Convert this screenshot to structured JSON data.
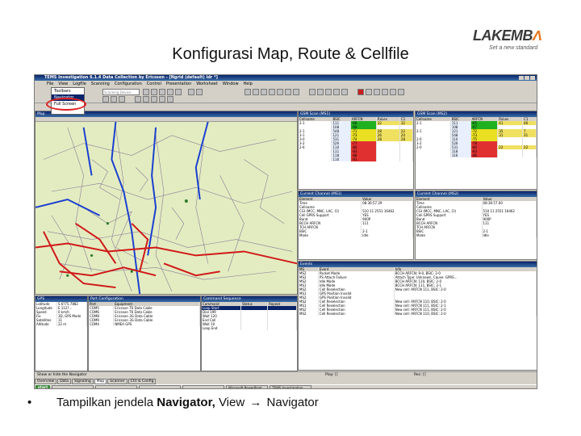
{
  "slide": {
    "title": "Konfigurasi Map, Route & Cellfile",
    "logo": {
      "word_a": "LAKEMB",
      "word_b": "Λ",
      "tagline": "Set a new standard"
    },
    "bullet": "•",
    "caption_prefix": "Tampilkan jendela ",
    "caption_bold": "Navigator,",
    "caption_view": " View ",
    "caption_arrow": "→",
    "caption_target": " Navigator"
  },
  "app": {
    "title": "TEMS Investigation 6.1.4 Data Collection by Ericsson - [Ngrid (default) ldr *]",
    "menu": [
      "File",
      "View",
      "Logfile",
      "Scanning",
      "Configuration",
      "Control",
      "Presentation",
      "Worksheet",
      "Window",
      "Help"
    ],
    "view_menu": [
      "Toolbars",
      "Navigator",
      "Full Screen"
    ],
    "toolbar_dropdown": "Scanning Device",
    "map_pane_title": "Map",
    "scan_pane_1": "GSM Scan (MS1)",
    "scan_pane_2": "GSM Scan (MS2)",
    "current_channel_1": "Current Channel (MS1)",
    "current_channel_2": "Current Channel (MS2)",
    "events_pane": "Events",
    "port_config_pane": "Port Configuration",
    "command_pane": "Command Sequence",
    "info_pane": "GPS",
    "scan_cols": [
      "Cellname",
      "BSIC",
      "ARFCN",
      "RxLev",
      "C1",
      "C2",
      "C31"
    ],
    "scan_rows_1": [
      [
        "2-1",
        "111",
        "-66",
        "32",
        "32"
      ],
      [
        "",
        "108",
        "-69",
        "",
        ""
      ],
      [
        "2-1",
        "548",
        "-71",
        "28",
        "22"
      ],
      [
        "3-1",
        "121",
        "-73",
        "26",
        "20"
      ],
      [
        "3-0",
        "531",
        "-74",
        "28",
        "28"
      ],
      [
        "3-2",
        "526",
        "-77",
        "",
        ""
      ],
      [
        "2-6",
        "110",
        "-80",
        "",
        ""
      ],
      [
        "",
        "111",
        "-83",
        "",
        ""
      ],
      [
        "",
        "118",
        "-88",
        "",
        ""
      ],
      [
        "",
        "116",
        "-91",
        "",
        ""
      ]
    ],
    "scan_rows_2": [
      [
        "2-1",
        "111",
        "-65",
        "41",
        "46"
      ],
      [
        "",
        "108",
        "-67",
        "",
        ""
      ],
      [
        "2-1",
        "121",
        "-72",
        "35",
        "7"
      ],
      [
        "",
        "548",
        "-73",
        "31",
        "31"
      ],
      [
        "2-0",
        "110",
        "-75",
        "",
        ""
      ],
      [
        "3-2",
        "526",
        "-78",
        "",
        ""
      ],
      [
        "2-0",
        "531",
        "-80",
        "22",
        "22"
      ],
      [
        "",
        "118",
        "-83",
        "",
        ""
      ],
      [
        "",
        "116",
        "-86",
        "",
        ""
      ]
    ],
    "channel_cols": [
      "Element",
      "Value"
    ],
    "channel_rows_1": [
      [
        "Time",
        "08:36:57.29"
      ],
      [
        "Cellname",
        ""
      ],
      [
        "CGI (MCC, MNC, LAC, CI)",
        "510 11 2551 16462"
      ],
      [
        "Cell GPRS Support",
        "YES"
      ],
      [
        "Band",
        "900P"
      ],
      [
        "BCCH ARFCN",
        "111"
      ],
      [
        "TCH ARFCN",
        ""
      ],
      [
        "BSIC",
        "2-1"
      ],
      [
        "Mode",
        "Idle"
      ]
    ],
    "channel_rows_2": [
      [
        "Time",
        "08:36:57.00"
      ],
      [
        "Cellname",
        ""
      ],
      [
        "CGI (MCC, MNC, LAC, CI)",
        "510 11 2551 16462"
      ],
      [
        "Cell GPRS Support",
        "YES"
      ],
      [
        "Band",
        "900P"
      ],
      [
        "BCCH ARFCN",
        "111"
      ],
      [
        "TCH ARFCN",
        ""
      ],
      [
        "BSIC",
        "2-1"
      ],
      [
        "Mode",
        "Idle"
      ]
    ],
    "event_cols": [
      "MS",
      "Event",
      "Info"
    ],
    "event_rows": [
      [
        "MS2",
        "Packet Mode",
        "BCCH ARFCN: 9-0, BSIC: 2-0"
      ],
      [
        "MS2",
        "PS Attach Failure",
        "Attach Type: Unknown, Cause: GPRS..."
      ],
      [
        "MS2",
        "Idle Mode",
        "BCCH ARFCN: 110, BSIC: 2-0"
      ],
      [
        "MS1",
        "Idle Mode",
        "BCCH ARFCN: 111, BSIC: 2-1"
      ],
      [
        "MS2",
        "Cell Reselection",
        "New cell: ARFCN 111, BSIC: 2-0"
      ],
      [
        "MS1",
        "GPS Position Invalid",
        ""
      ],
      [
        "MS2",
        "GPS Position Invalid",
        ""
      ],
      [
        "MS2",
        "Cell Reselection",
        "New cell: ARFCN 110, BSIC: 2-0"
      ],
      [
        "MS1",
        "Cell Reselection",
        "New cell: ARFCN 111, BSIC: 2-1"
      ],
      [
        "MS2",
        "Cell Reselection",
        "New cell: ARFCN 111, BSIC: 2-0"
      ],
      [
        "MS2",
        "Cell Reselection",
        "New cell: ARFCN 110, BSIC: 2-0"
      ]
    ],
    "gps_rows": [
      [
        "Latitude",
        "S 6?75.7882"
      ],
      [
        "Longitude",
        "E 112?..."
      ],
      [
        "Speed",
        "0 km/h"
      ],
      [
        "Fix",
        "3D, GPS Mode"
      ],
      [
        "Satellites",
        "11"
      ],
      [
        "Altitude",
        "22 m"
      ]
    ],
    "port_cols": [
      "Port",
      "Equipment"
    ],
    "port_rows": [
      [
        "COM5",
        "Ericsson T6 Data Cable"
      ],
      [
        "COM6",
        "Ericsson T6 Data Cable"
      ],
      [
        "COM8",
        "Ericsson 3G Data Cable"
      ],
      [
        "COM9",
        "Ericsson 3G Data Cable"
      ],
      [
        "COM4",
        "NMEA GPS"
      ]
    ],
    "command_cols": [
      "Command",
      "Status",
      "Repeat"
    ],
    "command_rows": [
      [
        "Loop Start",
        "",
        ""
      ],
      [
        "Dial 199",
        "",
        ""
      ],
      [
        "Wait 120",
        "",
        ""
      ],
      [
        "End Call",
        "",
        ""
      ],
      [
        "Wait 10",
        "",
        ""
      ],
      [
        "Loop End",
        "",
        ""
      ]
    ],
    "status_text": "Show or hide the Navigator",
    "status_play": "Play: []",
    "status_rec": "Rec: []",
    "tabs": [
      "Overview",
      "Data",
      "Signaling",
      "Map",
      "Scanner",
      "Ctrl & Config"
    ],
    "active_tab": "Map",
    "taskbar": {
      "start": "start",
      "items": [
        "",
        "",
        "",
        "",
        "Microsoft PowerPoint...",
        "TEMS Investigation..."
      ]
    }
  },
  "colors": {
    "accent_orange": "#e8761c",
    "selection": "#0a246a",
    "map_bg": "#e6eec6",
    "route_red": "#d01818",
    "route_blue": "#1a3fd0",
    "highlight_circle": "#e02020"
  }
}
